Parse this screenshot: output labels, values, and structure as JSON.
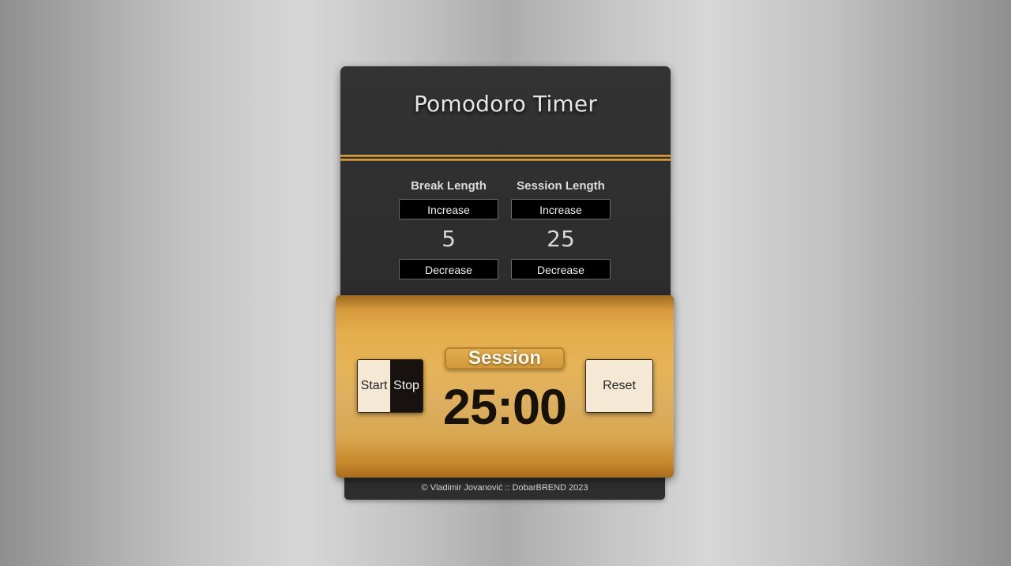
{
  "header": {
    "title": "Pomodoro Timer"
  },
  "controls": {
    "break": {
      "label": "Break Length",
      "increase_label": "Increase",
      "value": "5",
      "decrease_label": "Decrease"
    },
    "session": {
      "label": "Session Length",
      "increase_label": "Increase",
      "value": "25",
      "decrease_label": "Decrease"
    }
  },
  "timer": {
    "start_label": "Start",
    "stop_label": "Stop",
    "mode_label": "Session",
    "time_left": "25:00",
    "reset_label": "Reset"
  },
  "footer": {
    "text": "© Vladimir Jovanović :: DobarBREND 2023"
  },
  "colors": {
    "card": "#2e2e2e",
    "gold": "#e4ad4c",
    "cream": "#f5e9d6",
    "dark_button": "#000000"
  }
}
